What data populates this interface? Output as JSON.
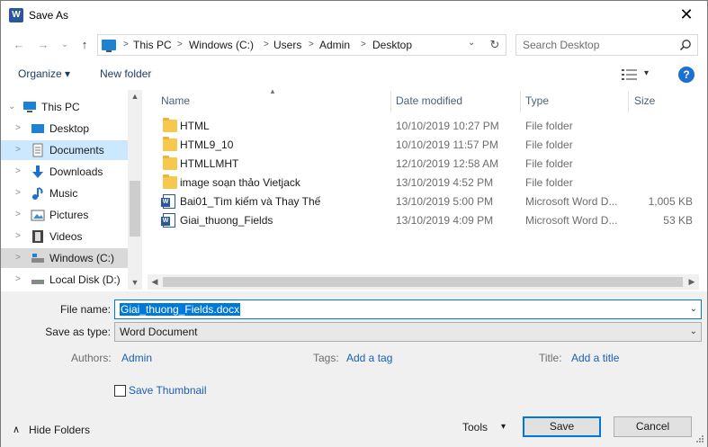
{
  "window": {
    "title": "Save As",
    "app_icon_letter": "W",
    "close_glyph": "✕"
  },
  "nav_buttons": {
    "back": "←",
    "forward": "→",
    "recent": "⌄",
    "up": "↑"
  },
  "address": {
    "crumbs": [
      "This PC",
      "Windows (C:)",
      "Users",
      "Admin",
      "Desktop"
    ],
    "separator": ">",
    "dropdown_glyph": "⌄",
    "refresh_glyph": "↻"
  },
  "search": {
    "placeholder": "Search Desktop",
    "icon": "search-icon"
  },
  "toolbar": {
    "organize_label": "Organize ▾",
    "new_folder_label": "New folder",
    "view_dropdown_glyph": "▾",
    "help_glyph": "?"
  },
  "nav_pane": {
    "items": [
      {
        "label": "This PC",
        "icon": "computer-icon",
        "chevron": "⌄"
      },
      {
        "label": "Desktop",
        "icon": "desktop-icon",
        "chevron": ">"
      },
      {
        "label": "Documents",
        "icon": "documents-icon",
        "chevron": ">"
      },
      {
        "label": "Downloads",
        "icon": "downloads-icon",
        "chevron": ">"
      },
      {
        "label": "Music",
        "icon": "music-icon",
        "chevron": ">"
      },
      {
        "label": "Pictures",
        "icon": "pictures-icon",
        "chevron": ">"
      },
      {
        "label": "Videos",
        "icon": "videos-icon",
        "chevron": ">"
      },
      {
        "label": "Windows (C:)",
        "icon": "drive-icon",
        "chevron": ">"
      },
      {
        "label": "Local Disk (D:)",
        "icon": "drive-icon",
        "chevron": ">"
      }
    ]
  },
  "columns": {
    "name": "Name",
    "date_modified": "Date modified",
    "type": "Type",
    "size": "Size"
  },
  "files": [
    {
      "name": "HTML",
      "date": "10/10/2019 10:27 PM",
      "type": "File folder",
      "size": "",
      "kind": "folder"
    },
    {
      "name": "HTML9_10",
      "date": "10/10/2019 11:57 PM",
      "type": "File folder",
      "size": "",
      "kind": "folder"
    },
    {
      "name": "HTMLLMHT",
      "date": "12/10/2019 12:58 AM",
      "type": "File folder",
      "size": "",
      "kind": "folder"
    },
    {
      "name": "image soạn thảo Vietjack",
      "date": "13/10/2019 4:52 PM",
      "type": "File folder",
      "size": "",
      "kind": "folder"
    },
    {
      "name": "Bai01_Tìm kiếm và Thay Thế",
      "date": "13/10/2019 5:00 PM",
      "type": "Microsoft Word D...",
      "size": "1,005 KB",
      "kind": "word"
    },
    {
      "name": "Giai_thuong_Fields",
      "date": "13/10/2019 4:09 PM",
      "type": "Microsoft Word D...",
      "size": "53 KB",
      "kind": "word"
    }
  ],
  "form": {
    "file_name_label": "File name:",
    "file_name_value": "Giai_thuong_Fields.docx",
    "save_as_type_label": "Save as type:",
    "save_as_type_value": "Word Document",
    "authors_label": "Authors:",
    "authors_value": "Admin",
    "tags_label": "Tags:",
    "tags_value": "Add a tag",
    "title_label": "Title:",
    "title_value": "Add a title",
    "save_thumbnail_label": "Save Thumbnail",
    "save_thumbnail_checked": false
  },
  "footer": {
    "hide_folders_label": "Hide Folders",
    "hide_folders_glyph": "∧",
    "tools_label": "Tools",
    "tools_glyph": "▾",
    "save_label": "Save",
    "cancel_label": "Cancel"
  },
  "colors": {
    "accent": "#0078d7",
    "selection_bg": "#cce8ff",
    "link": "#1a5fb4",
    "folder": "#f6c94e",
    "word": "#2b579a"
  }
}
